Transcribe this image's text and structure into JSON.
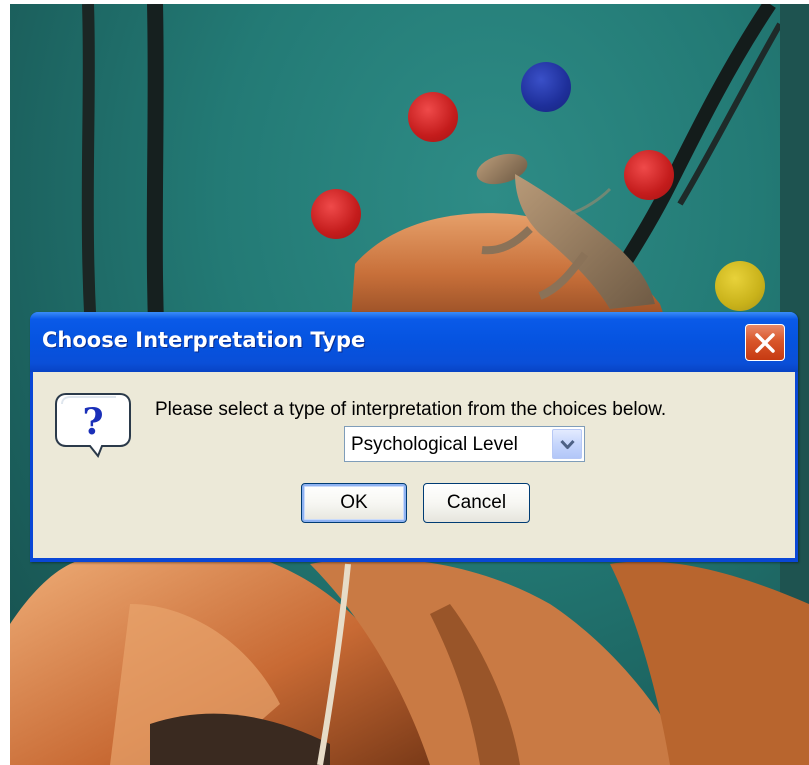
{
  "dialog": {
    "title": "Choose Interpretation Type",
    "message": "Please select a type of interpretation from the choices below.",
    "interpretation_select": {
      "selected": "Psychological Level"
    },
    "buttons": {
      "ok": "OK",
      "cancel": "Cancel"
    },
    "icon": "question-bubble-icon",
    "close_icon": "close-icon"
  },
  "background": {
    "description_icon": "lizard-photo",
    "dots": [
      {
        "color": "#cc1f1f"
      },
      {
        "color": "#20339e"
      },
      {
        "color": "#cc1f1f"
      },
      {
        "color": "#cc1f1f"
      },
      {
        "color": "#c9b21a"
      }
    ]
  },
  "colors": {
    "titlebar": "#0553e0",
    "client": "#ece9d8",
    "close_button": "#d9562a"
  }
}
